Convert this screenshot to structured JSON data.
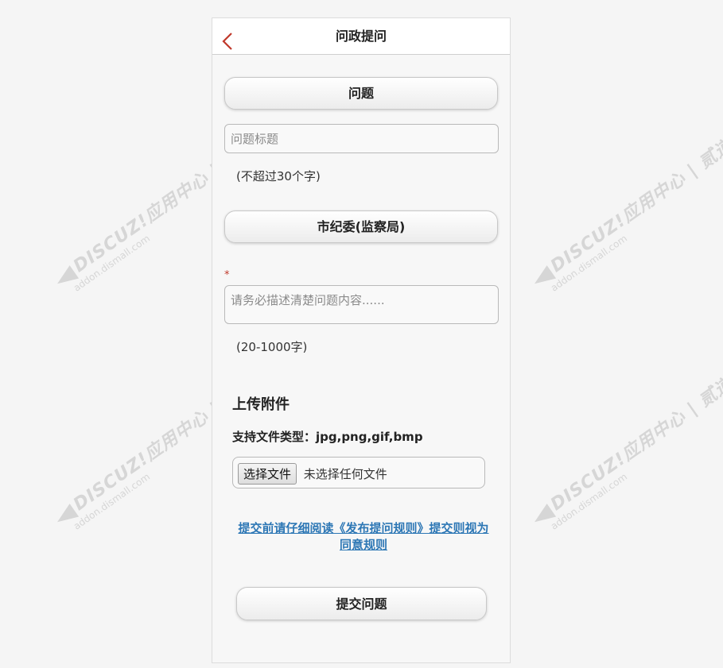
{
  "watermark": {
    "brand": "DISCUZ!应用中心 | 贰道",
    "domain": "addon.dismall.com"
  },
  "header": {
    "title": "问政提问",
    "accent_color": "#c0392b"
  },
  "form": {
    "section_question": "问题",
    "title_placeholder": "问题标题",
    "title_hint": "(不超过30个字)",
    "department": "市纪委(监察局)",
    "required_mark": "*",
    "content_placeholder": "请务必描述清楚问题内容......",
    "content_hint": "(20-1000字)",
    "upload_heading": "上传附件",
    "file_types": "支持文件类型：jpg,png,gif,bmp",
    "file_button": "选择文件",
    "file_status": "未选择任何文件",
    "rules_link": "提交前请仔细阅读《发布提问规则》提交则视为同意规则",
    "submit": "提交问题"
  }
}
